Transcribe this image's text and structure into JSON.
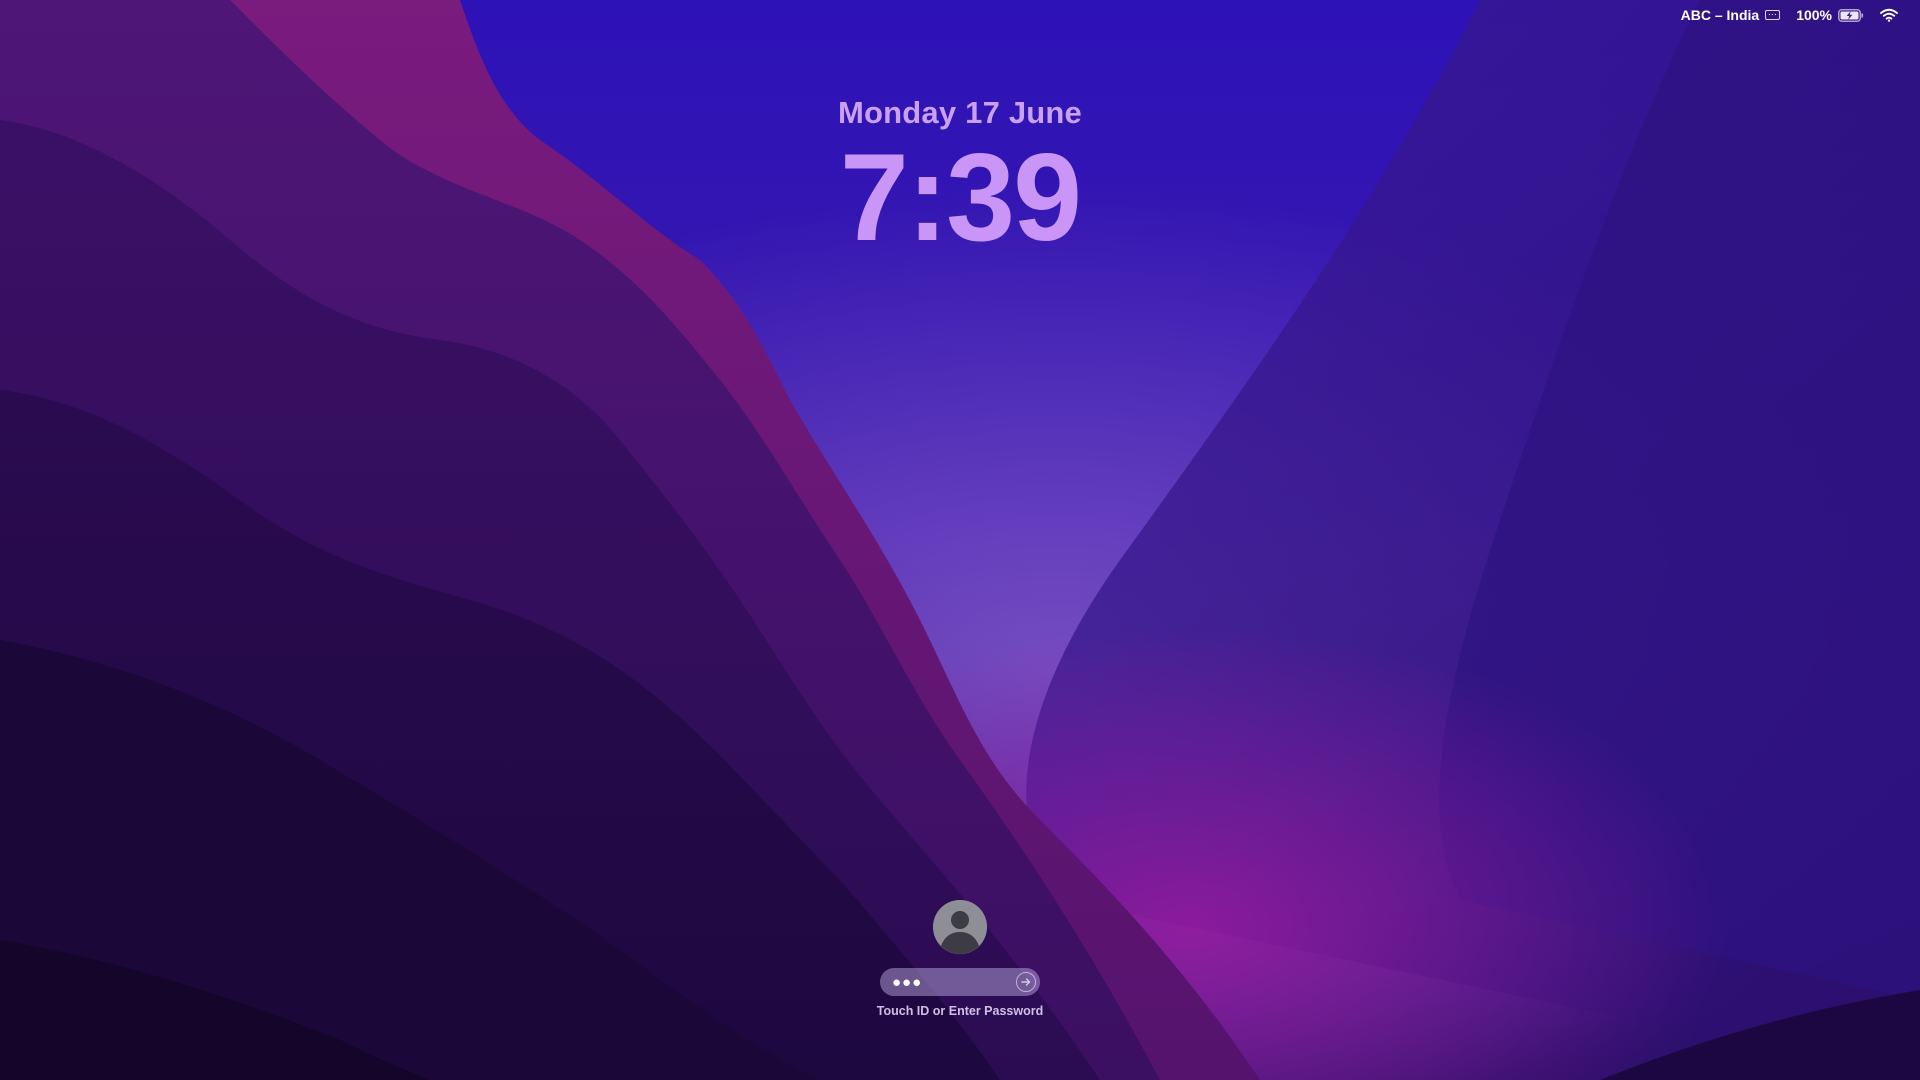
{
  "status_bar": {
    "input_source": "ABC – India",
    "input_source_icon": "keyboard-icon",
    "battery_percent": "100%",
    "battery_icon": "battery-charging-icon",
    "wifi_icon": "wifi-icon"
  },
  "lock_screen": {
    "date": "Monday 17 June",
    "time": "7:39"
  },
  "login": {
    "avatar_icon": "user-avatar-icon",
    "password_value": "●●●",
    "submit_icon": "arrow-right-circle-icon",
    "hint": "Touch ID or Enter Password"
  },
  "colors": {
    "clock": "#c996f7",
    "wallpaper_base": "#2a1270",
    "accent_magenta": "#8a1c8c"
  }
}
